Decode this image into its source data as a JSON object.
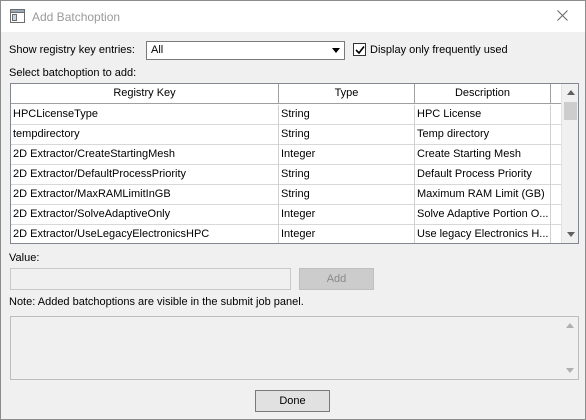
{
  "window": {
    "title": "Add Batchoption",
    "icon": "window-app-icon",
    "close_icon": "close-icon"
  },
  "filter": {
    "label": "Show registry key entries:",
    "selected": "All",
    "checkbox_label": "Display only frequently used",
    "checkbox_checked": true
  },
  "grid": {
    "label": "Select batchoption to add:",
    "columns": [
      "Registry Key",
      "Type",
      "Description"
    ],
    "rows": [
      {
        "key": "HPCLicenseType",
        "type": "String",
        "desc": "HPC License"
      },
      {
        "key": "tempdirectory",
        "type": "String",
        "desc": "Temp directory"
      },
      {
        "key": "2D Extractor/CreateStartingMesh",
        "type": "Integer",
        "desc": "Create Starting Mesh"
      },
      {
        "key": "2D Extractor/DefaultProcessPriority",
        "type": "String",
        "desc": "Default Process Priority"
      },
      {
        "key": "2D Extractor/MaxRAMLimitInGB",
        "type": "String",
        "desc": "Maximum RAM Limit (GB)"
      },
      {
        "key": "2D Extractor/SolveAdaptiveOnly",
        "type": "Integer",
        "desc": "Solve Adaptive Portion O..."
      },
      {
        "key": "2D Extractor/UseLegacyElectronicsHPC",
        "type": "Integer",
        "desc": "Use legacy Electronics H..."
      }
    ]
  },
  "value": {
    "label": "Value:",
    "input_value": "",
    "add_label": "Add"
  },
  "note": {
    "text": "Note: Added batchoptions are visible in the submit job panel.",
    "content": ""
  },
  "footer": {
    "done_label": "Done"
  }
}
